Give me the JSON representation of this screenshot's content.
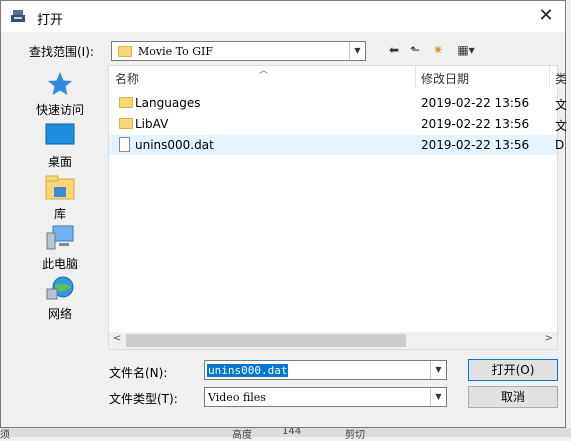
{
  "dialog": {
    "title": "打开"
  },
  "lookin": {
    "label": "查找范围(I):",
    "value": "Movie To GIF"
  },
  "toolbar": {
    "back": "⬅",
    "up": "⬑",
    "newfolder": "✷",
    "view": "▦▾"
  },
  "places": [
    {
      "label": "快速访问",
      "icon": "star-icon"
    },
    {
      "label": "桌面",
      "icon": "desktop-icon"
    },
    {
      "label": "库",
      "icon": "library-icon"
    },
    {
      "label": "此电脑",
      "icon": "computer-icon"
    },
    {
      "label": "网络",
      "icon": "network-icon"
    }
  ],
  "columns": {
    "name": "名称",
    "date": "修改日期",
    "more": "类"
  },
  "files": [
    {
      "name": "Languages",
      "date": "2019-02-22 13:56",
      "trunc": "文",
      "type": "folder"
    },
    {
      "name": "LibAV",
      "date": "2019-02-22 13:56",
      "trunc": "文",
      "type": "folder"
    },
    {
      "name": "unins000.dat",
      "date": "2019-02-22 13:56",
      "trunc": "D",
      "type": "file",
      "selected": true
    }
  ],
  "filename": {
    "label": "文件名(N):",
    "value": "unins000.dat"
  },
  "filetype": {
    "label": "文件类型(T):",
    "value": "Video files"
  },
  "buttons": {
    "open": "打开(O)",
    "cancel": "取消"
  },
  "background": {
    "left_text": "须",
    "mid_text": "高度",
    "num_text": "144",
    "right_text": "剪切"
  }
}
